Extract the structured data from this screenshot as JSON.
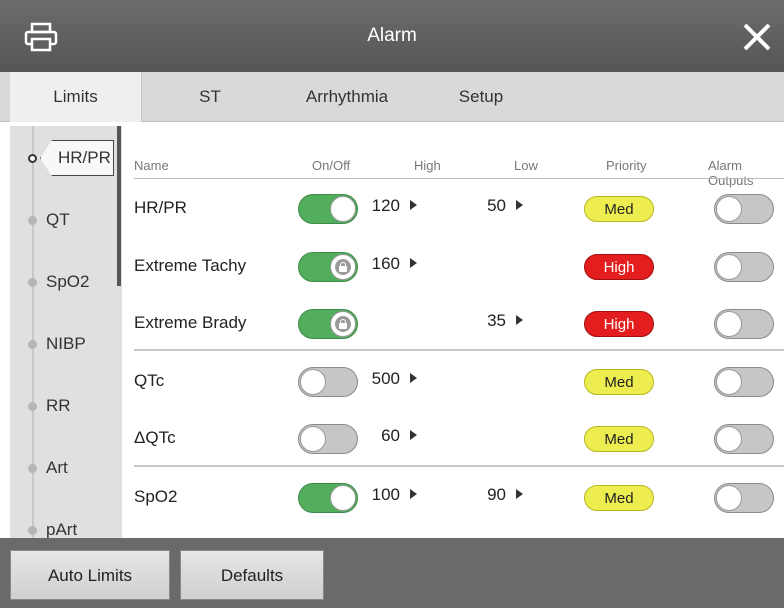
{
  "window": {
    "title": "Alarm"
  },
  "tabs": [
    {
      "label": "Limits"
    },
    {
      "label": "ST"
    },
    {
      "label": "Arrhythmia"
    },
    {
      "label": "Setup"
    }
  ],
  "nav": {
    "items": [
      {
        "label": "HR/PR",
        "active": true
      },
      {
        "label": "QT"
      },
      {
        "label": "SpO2"
      },
      {
        "label": "NIBP"
      },
      {
        "label": "RR"
      },
      {
        "label": "Art"
      },
      {
        "label": "pArt"
      }
    ]
  },
  "table": {
    "columns": {
      "name": "Name",
      "onoff": "On/Off",
      "high": "High",
      "low": "Low",
      "priority": "Priority",
      "outputs": "Alarm Outputs"
    },
    "rows": [
      {
        "name": "HR/PR",
        "on": true,
        "locked": false,
        "high": "120",
        "low": "50",
        "priority": "Med",
        "output": false
      },
      {
        "name": "Extreme Tachy",
        "on": true,
        "locked": true,
        "high": "160",
        "low": "",
        "priority": "High",
        "output": false
      },
      {
        "name": "Extreme Brady",
        "on": true,
        "locked": true,
        "high": "",
        "low": "35",
        "priority": "High",
        "output": false
      },
      {
        "name": "QTc",
        "on": false,
        "locked": false,
        "high": "500",
        "low": "",
        "priority": "Med",
        "output": false
      },
      {
        "name": "ΔQTc",
        "on": false,
        "locked": false,
        "high": "60",
        "low": "",
        "priority": "Med",
        "output": false
      },
      {
        "name": "SpO2",
        "on": true,
        "locked": false,
        "high": "100",
        "low": "90",
        "priority": "Med",
        "output": false
      }
    ]
  },
  "footer": {
    "auto_limits_label": "Auto Limits",
    "defaults_label": "Defaults"
  },
  "colors": {
    "toggle_on": "#52ad5d",
    "priority_med": "#eded50",
    "priority_high": "#e41e1e"
  },
  "icons": {
    "print": "printer-icon",
    "close": "close-icon",
    "lock": "lock-icon",
    "arrow": "triangle-right-icon"
  }
}
